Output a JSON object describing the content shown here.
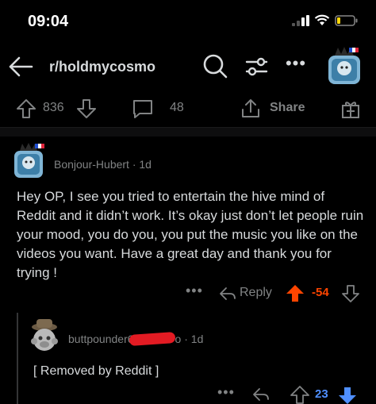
{
  "status_bar": {
    "time": "09:04"
  },
  "nav": {
    "subreddit": "r/holdmycosmo",
    "icons": [
      "back-arrow-icon",
      "search-icon",
      "filter-sliders-icon",
      "more-icon",
      "avatar"
    ]
  },
  "post_actions": {
    "upvotes": "836",
    "comments": "48",
    "share_label": "Share"
  },
  "comment": {
    "author": "Bonjour-Hubert",
    "age": "1d",
    "body": "Hey OP, I see you tried to entertain the hive mind of Reddit and it didn’t work. It’s okay just don’t let people ruin your mood, you do you, you put the music you like on the videos you want. Have a great day and thank you for trying !",
    "more": "•••",
    "reply_label": "Reply",
    "score": "-54",
    "score_color": "#ff4500"
  },
  "reply": {
    "author_visible": "buttpounder6",
    "author_tail": "o",
    "age": "1d",
    "body": "[ Removed by Reddit ]",
    "more": "•••",
    "score": "23",
    "score_color": "#4f8fff"
  },
  "colors": {
    "background": "#000000",
    "text": "#d7dadc",
    "muted": "#818384",
    "downvote_orange": "#ff4500",
    "upvote_blue": "#4f8fff"
  }
}
